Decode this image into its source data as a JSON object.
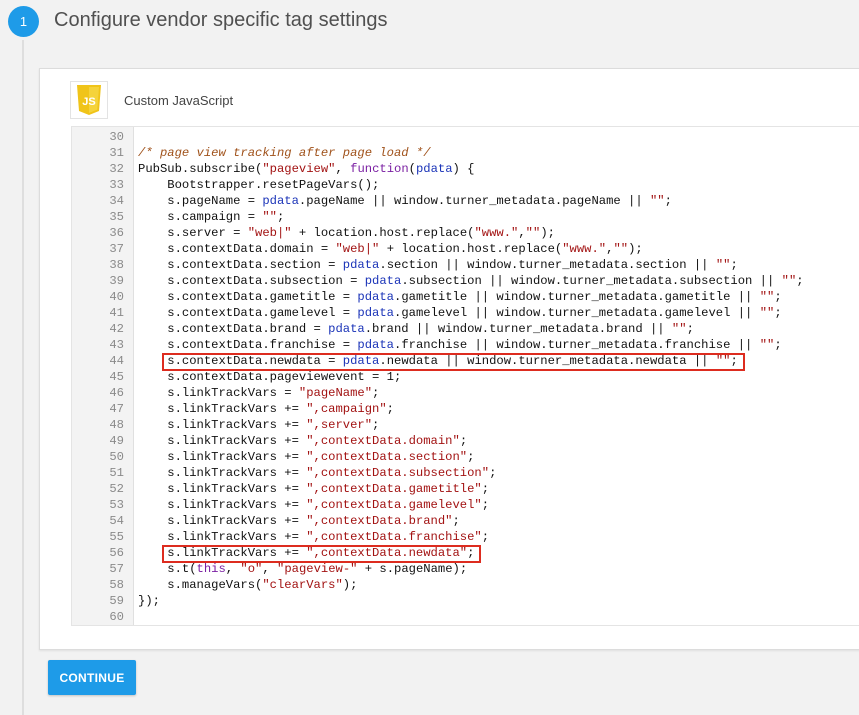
{
  "step": {
    "number": "1",
    "title": "Configure vendor specific tag settings"
  },
  "tag": {
    "icon": "js-icon",
    "icon_text": "JS",
    "name": "Custom JavaScript"
  },
  "code_lines": [
    {
      "n": "30",
      "t": []
    },
    {
      "n": "31",
      "t": [
        [
          "c-com",
          "/* page view tracking after page load */"
        ]
      ]
    },
    {
      "n": "32",
      "t": [
        [
          "",
          "PubSub.subscribe("
        ],
        [
          "c-str",
          "\"pageview\""
        ],
        [
          "",
          ", "
        ],
        [
          "c-kw",
          "function"
        ],
        [
          "",
          "("
        ],
        [
          "c-var",
          "pdata"
        ],
        [
          "",
          ") {"
        ]
      ]
    },
    {
      "n": "33",
      "t": [
        [
          "",
          "    Bootstrapper.resetPageVars();"
        ]
      ]
    },
    {
      "n": "34",
      "t": [
        [
          "",
          "    s.pageName = "
        ],
        [
          "c-var",
          "pdata"
        ],
        [
          "",
          ".pageName || window.turner_metadata.pageName || "
        ],
        [
          "c-str",
          "\"\""
        ],
        [
          "",
          ";"
        ]
      ]
    },
    {
      "n": "35",
      "t": [
        [
          "",
          "    s.campaign = "
        ],
        [
          "c-str",
          "\"\""
        ],
        [
          "",
          ";"
        ]
      ]
    },
    {
      "n": "36",
      "t": [
        [
          "",
          "    s.server = "
        ],
        [
          "c-str",
          "\"web|\""
        ],
        [
          "",
          " + location.host.replace("
        ],
        [
          "c-str",
          "\"www.\""
        ],
        [
          "",
          ","
        ],
        [
          "c-str",
          "\"\""
        ],
        [
          "",
          ");"
        ]
      ]
    },
    {
      "n": "37",
      "t": [
        [
          "",
          "    s.contextData.domain = "
        ],
        [
          "c-str",
          "\"web|\""
        ],
        [
          "",
          " + location.host.replace("
        ],
        [
          "c-str",
          "\"www.\""
        ],
        [
          "",
          ","
        ],
        [
          "c-str",
          "\"\""
        ],
        [
          "",
          ");"
        ]
      ]
    },
    {
      "n": "38",
      "t": [
        [
          "",
          "    s.contextData.section = "
        ],
        [
          "c-var",
          "pdata"
        ],
        [
          "",
          ".section || window.turner_metadata.section || "
        ],
        [
          "c-str",
          "\"\""
        ],
        [
          "",
          ";"
        ]
      ]
    },
    {
      "n": "39",
      "t": [
        [
          "",
          "    s.contextData.subsection = "
        ],
        [
          "c-var",
          "pdata"
        ],
        [
          "",
          ".subsection || window.turner_metadata.subsection || "
        ],
        [
          "c-str",
          "\"\""
        ],
        [
          "",
          ";"
        ]
      ]
    },
    {
      "n": "40",
      "t": [
        [
          "",
          "    s.contextData.gametitle = "
        ],
        [
          "c-var",
          "pdata"
        ],
        [
          "",
          ".gametitle || window.turner_metadata.gametitle || "
        ],
        [
          "c-str",
          "\"\""
        ],
        [
          "",
          ";"
        ]
      ]
    },
    {
      "n": "41",
      "t": [
        [
          "",
          "    s.contextData.gamelevel = "
        ],
        [
          "c-var",
          "pdata"
        ],
        [
          "",
          ".gamelevel || window.turner_metadata.gamelevel || "
        ],
        [
          "c-str",
          "\"\""
        ],
        [
          "",
          ";"
        ]
      ]
    },
    {
      "n": "42",
      "t": [
        [
          "",
          "    s.contextData.brand = "
        ],
        [
          "c-var",
          "pdata"
        ],
        [
          "",
          ".brand || window.turner_metadata.brand || "
        ],
        [
          "c-str",
          "\"\""
        ],
        [
          "",
          ";"
        ]
      ]
    },
    {
      "n": "43",
      "t": [
        [
          "",
          "    s.contextData.franchise = "
        ],
        [
          "c-var",
          "pdata"
        ],
        [
          "",
          ".franchise || window.turner_metadata.franchise || "
        ],
        [
          "c-str",
          "\"\""
        ],
        [
          "",
          ";"
        ]
      ]
    },
    {
      "n": "44",
      "t": [
        [
          "",
          "    s.contextData.newdata = "
        ],
        [
          "c-var",
          "pdata"
        ],
        [
          "",
          ".newdata || window.turner_metadata.newdata || "
        ],
        [
          "c-str",
          "\"\""
        ],
        [
          "",
          ";"
        ]
      ]
    },
    {
      "n": "45",
      "t": [
        [
          "",
          "    s.contextData.pageviewevent = 1;"
        ]
      ]
    },
    {
      "n": "46",
      "t": [
        [
          "",
          "    s.linkTrackVars = "
        ],
        [
          "c-str",
          "\"pageName\""
        ],
        [
          "",
          ";"
        ]
      ]
    },
    {
      "n": "47",
      "t": [
        [
          "",
          "    s.linkTrackVars += "
        ],
        [
          "c-str",
          "\",campaign\""
        ],
        [
          "",
          ";"
        ]
      ]
    },
    {
      "n": "48",
      "t": [
        [
          "",
          "    s.linkTrackVars += "
        ],
        [
          "c-str",
          "\",server\""
        ],
        [
          "",
          ";"
        ]
      ]
    },
    {
      "n": "49",
      "t": [
        [
          "",
          "    s.linkTrackVars += "
        ],
        [
          "c-str",
          "\",contextData.domain\""
        ],
        [
          "",
          ";"
        ]
      ]
    },
    {
      "n": "50",
      "t": [
        [
          "",
          "    s.linkTrackVars += "
        ],
        [
          "c-str",
          "\",contextData.section\""
        ],
        [
          "",
          ";"
        ]
      ]
    },
    {
      "n": "51",
      "t": [
        [
          "",
          "    s.linkTrackVars += "
        ],
        [
          "c-str",
          "\",contextData.subsection\""
        ],
        [
          "",
          ";"
        ]
      ]
    },
    {
      "n": "52",
      "t": [
        [
          "",
          "    s.linkTrackVars += "
        ],
        [
          "c-str",
          "\",contextData.gametitle\""
        ],
        [
          "",
          ";"
        ]
      ]
    },
    {
      "n": "53",
      "t": [
        [
          "",
          "    s.linkTrackVars += "
        ],
        [
          "c-str",
          "\",contextData.gamelevel\""
        ],
        [
          "",
          ";"
        ]
      ]
    },
    {
      "n": "54",
      "t": [
        [
          "",
          "    s.linkTrackVars += "
        ],
        [
          "c-str",
          "\",contextData.brand\""
        ],
        [
          "",
          ";"
        ]
      ]
    },
    {
      "n": "55",
      "t": [
        [
          "",
          "    s.linkTrackVars += "
        ],
        [
          "c-str",
          "\",contextData.franchise\""
        ],
        [
          "",
          ";"
        ]
      ]
    },
    {
      "n": "56",
      "t": [
        [
          "",
          "    s.linkTrackVars += "
        ],
        [
          "c-str",
          "\",contextData.newdata\""
        ],
        [
          "",
          ";"
        ]
      ]
    },
    {
      "n": "57",
      "t": [
        [
          "",
          "    s.t("
        ],
        [
          "c-kw",
          "this"
        ],
        [
          "",
          ", "
        ],
        [
          "c-str",
          "\"o\""
        ],
        [
          "",
          ", "
        ],
        [
          "c-str",
          "\"pageview-\""
        ],
        [
          "",
          " + s.pageName);"
        ]
      ]
    },
    {
      "n": "58",
      "t": [
        [
          "",
          "    s.manageVars("
        ],
        [
          "c-str",
          "\"clearVars\""
        ],
        [
          "",
          ");"
        ]
      ]
    },
    {
      "n": "59",
      "t": [
        [
          "",
          "});"
        ]
      ]
    },
    {
      "n": "60",
      "t": []
    }
  ],
  "highlight_lines": [
    "44",
    "56"
  ],
  "colors": {
    "accent": "#1e9be8",
    "highlight": "#dd2c1f",
    "js_yellow": "#f0c419"
  },
  "actions": {
    "continue_label": "CONTINUE"
  }
}
